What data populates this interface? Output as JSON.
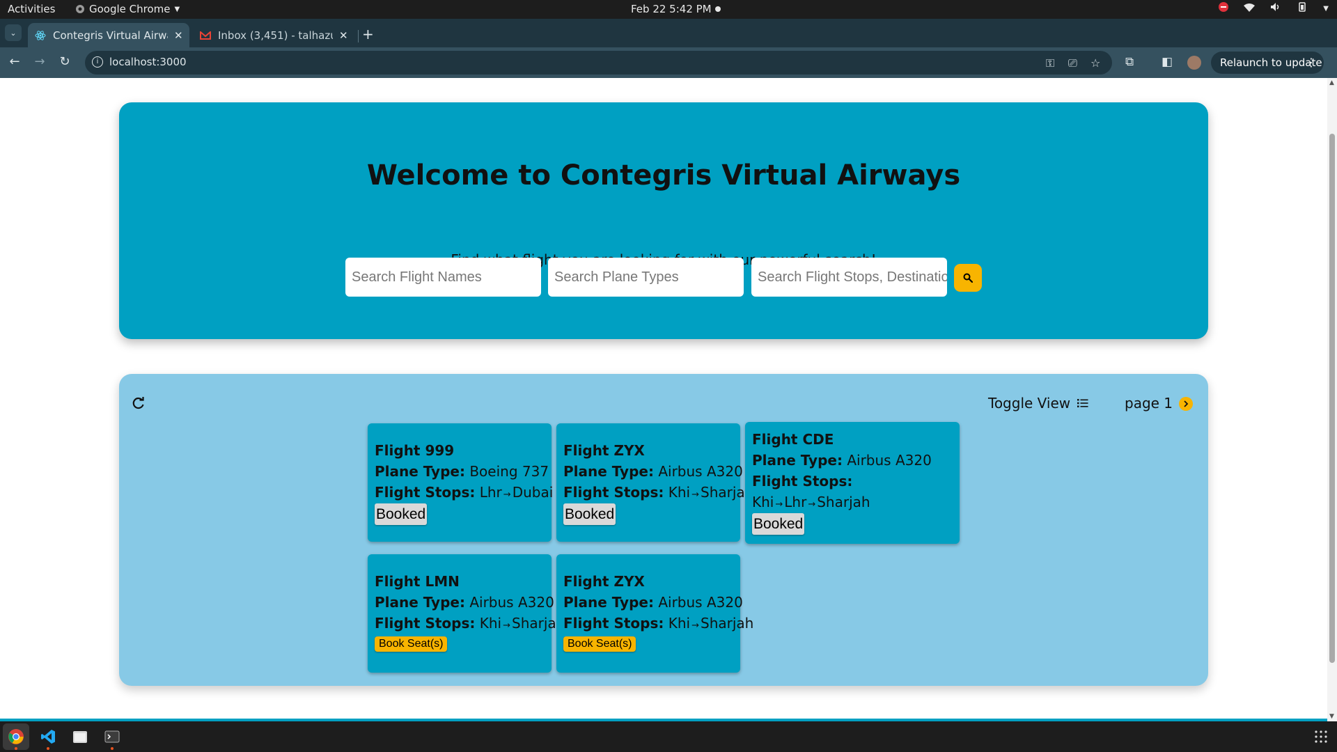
{
  "system": {
    "activities": "Activities",
    "app_name": "Google Chrome",
    "datetime": "Feb 22  5:42 PM"
  },
  "browser": {
    "tabs": [
      {
        "title": "Contegris Virtual Airways",
        "active": true
      },
      {
        "title": "Inbox (3,451) - talhazubair",
        "active": false
      }
    ],
    "url": "localhost:3000",
    "relaunch_label": "Relaunch to update"
  },
  "hero": {
    "title": "Welcome to Contegris Virtual Airways",
    "subtitle": "Find what flight you are looking for with our powerful search!",
    "search": {
      "flight_names_placeholder": "Search Flight Names",
      "plane_types_placeholder": "Search Plane Types",
      "stops_placeholder": "Search Flight Stops, Destinations"
    }
  },
  "results": {
    "toggle_label": "Toggle View",
    "page_label": "page 1",
    "labels": {
      "plane_type": "Plane Type:",
      "flight_stops": "Flight Stops:",
      "arrow": "→"
    },
    "flights": [
      {
        "name": "Flight 999",
        "plane": "Boeing 737",
        "stops": [
          "Lhr",
          "Dubai"
        ],
        "status": "Booked"
      },
      {
        "name": "Flight ZYX",
        "plane": "Airbus A320",
        "stops": [
          "Khi",
          "Sharjah"
        ],
        "status": "Booked"
      },
      {
        "name": "Flight CDE",
        "plane": "Airbus A320",
        "stops": [
          "Khi",
          "Lhr",
          "Sharjah"
        ],
        "status": "Booked"
      },
      {
        "name": "Flight LMN",
        "plane": "Airbus A320",
        "stops": [
          "Khi",
          "Sharjah"
        ],
        "status": "Book Seat(s)"
      },
      {
        "name": "Flight ZYX",
        "plane": "Airbus A320",
        "stops": [
          "Khi",
          "Sharjah"
        ],
        "status": "Book Seat(s)"
      }
    ]
  },
  "colors": {
    "hero_bg": "#00a0c2",
    "results_bg": "#87c9e6",
    "accent": "#f8b400",
    "booked_badge": "#d9d9d9"
  },
  "icons": {
    "search_button": "search-icon",
    "refresh": "refresh-icon",
    "toggle": "list-icon",
    "next_page": "chevron-right-icon"
  }
}
